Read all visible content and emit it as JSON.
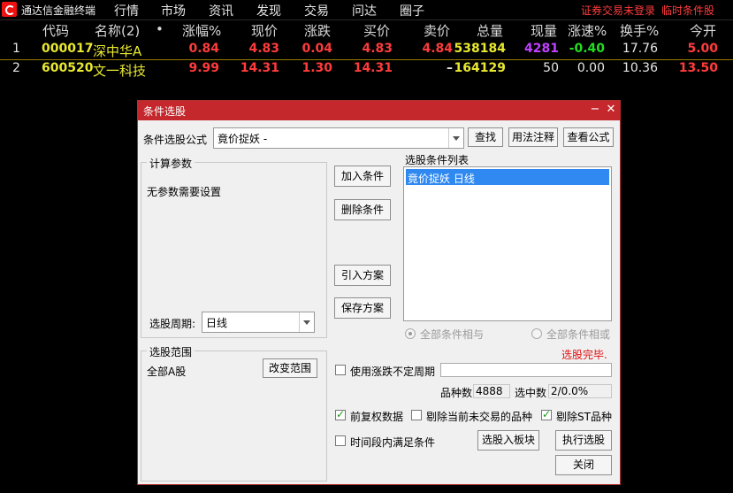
{
  "app": {
    "title": "通达信金融终端"
  },
  "menu": [
    "行情",
    "市场",
    "资讯",
    "发现",
    "交易",
    "问达",
    "圈子"
  ],
  "status": {
    "login": "证券交易未登录",
    "condition": "临时条件股"
  },
  "table": {
    "headers": [
      "代码",
      "名称(2)",
      "•",
      "涨幅%",
      "现价",
      "涨跌",
      "买价",
      "卖价",
      "总量",
      "现量",
      "涨速%",
      "换手%",
      "今开"
    ],
    "rows": [
      {
        "idx": "1",
        "code": "000017",
        "name": "深中华A",
        "change_pct": "0.84",
        "price": "4.83",
        "change": "0.04",
        "bid": "4.83",
        "ask": "4.84",
        "volume": "538184",
        "cur_vol": "4281",
        "speed": "-0.40",
        "turnover": "17.76",
        "open": "5.00"
      },
      {
        "idx": "2",
        "code": "600520",
        "name": "文一科技",
        "change_pct": "9.99",
        "price": "14.31",
        "change": "1.30",
        "bid": "14.31",
        "ask": "–",
        "volume": "164129",
        "cur_vol": "50",
        "speed": "0.00",
        "turnover": "10.36",
        "open": "13.50"
      }
    ]
  },
  "colors": {
    "red": "#ff3b3b",
    "yellow": "#e8e830",
    "green": "#22dd22",
    "purple": "#c040ff",
    "white": "#e6e6e6"
  },
  "dialog": {
    "title": "条件选股",
    "formula_label": "条件选股公式",
    "formula_value": "竟价捉妖      -",
    "btn_find": "查找",
    "btn_usage": "用法注释",
    "btn_view": "查看公式",
    "calc_group": "计算参数",
    "no_params": "无参数需要设置",
    "period_label": "选股周期:",
    "period_value": "日线",
    "btn_add": "加入条件",
    "btn_delete": "删除条件",
    "btn_import": "引入方案",
    "btn_save": "保存方案",
    "list_label": "选股条件列表",
    "list_items": [
      "竟价捉妖  日线"
    ],
    "radio_and": "全部条件相与",
    "radio_or": "全部条件相或",
    "range_group": "选股范围",
    "range_value": "全部A股",
    "btn_change_range": "改变范围",
    "done_text": "选股完毕.",
    "use_period": "使用涨跌不定周期",
    "count_label": "品种数",
    "count_value": "4888",
    "selected_label": "选中数",
    "selected_value": "2/0.0%",
    "chk_prefq": "前复权数据",
    "chk_exclude_untraded": "剔除当前未交易的品种",
    "chk_exclude_st": "剔除ST品种",
    "chk_time_range": "时间段内满足条件",
    "btn_to_block": "选股入板块",
    "btn_run": "执行选股",
    "btn_close": "关闭"
  }
}
